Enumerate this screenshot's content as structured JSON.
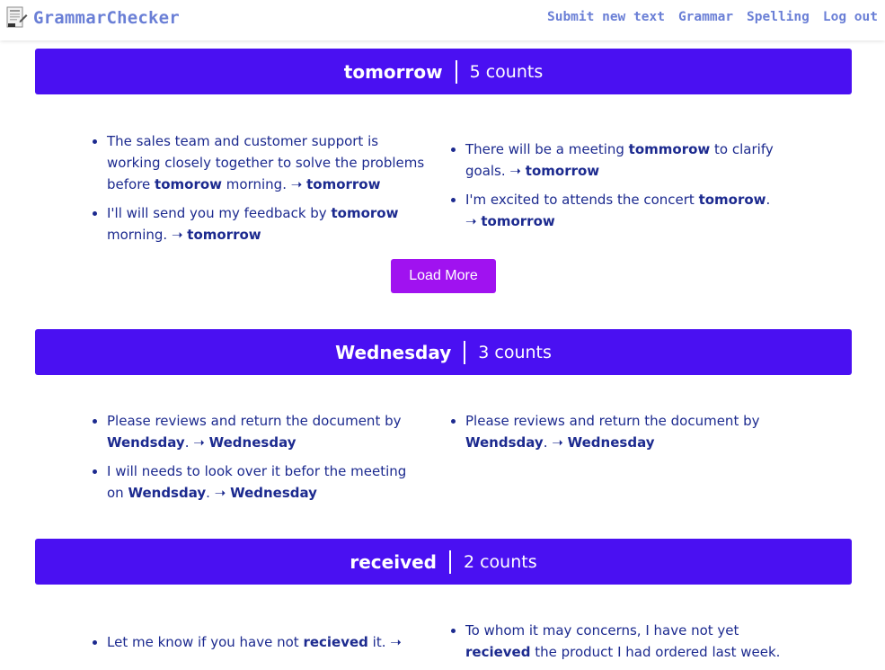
{
  "header": {
    "brand": "GrammarChecker",
    "nav": [
      "Submit new text",
      "Grammar",
      "Spelling",
      "Log out"
    ]
  },
  "sections": [
    {
      "word": "tomorrow",
      "count": "5 counts",
      "left": [
        {
          "before": "The sales team and customer support is working closely together to solve the problems before ",
          "error": "tomorow",
          "after": " morning. ",
          "arrow": "➝",
          "correction": "tomorrow"
        },
        {
          "before": "I'll will send you my feedback by ",
          "error": "tomorow",
          "after": " morning. ",
          "arrow": "➝",
          "correction": "tomorrow"
        }
      ],
      "right": [
        {
          "before": "There will be a meeting ",
          "error": "tommorow",
          "after": " to clarify goals. ",
          "arrow": "➝",
          "correction": "tomorrow"
        },
        {
          "before": "I'm excited to attends the concert ",
          "error": "tomorow",
          "after": ". ",
          "arrow": "➝",
          "correction": "tomorrow"
        }
      ],
      "load_more": "Load More"
    },
    {
      "word": "Wednesday",
      "count": "3 counts",
      "left": [
        {
          "before": "Please reviews and return the document by ",
          "error": "Wendsday",
          "after": ". ",
          "arrow": "➝",
          "correction": "Wednesday"
        },
        {
          "before": "I will needs to look over it befor the meeting on ",
          "error": "Wendsday",
          "after": ". ",
          "arrow": "➝",
          "correction": "Wednesday"
        }
      ],
      "right": [
        {
          "before": "Please reviews and return the document by ",
          "error": "Wendsday",
          "after": ". ",
          "arrow": "➝",
          "correction": "Wednesday"
        }
      ]
    },
    {
      "word": "received",
      "count": "2 counts",
      "left": [
        {
          "before": "Let me know if you have not ",
          "error": "recieved",
          "after": " it. ",
          "arrow": "➝",
          "correction": ""
        }
      ],
      "right": [
        {
          "before": "To whom it may concerns, I have not yet ",
          "error": "recieved",
          "after": " the product I had ordered last week.",
          "arrow": "",
          "correction": ""
        }
      ]
    }
  ]
}
